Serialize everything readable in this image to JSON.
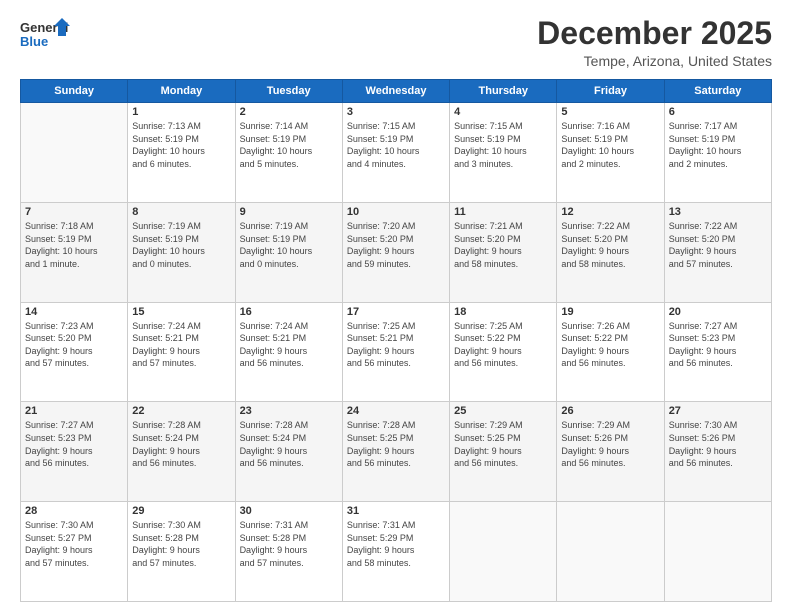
{
  "header": {
    "logo_line1": "General",
    "logo_line2": "Blue",
    "title": "December 2025",
    "subtitle": "Tempe, Arizona, United States"
  },
  "weekdays": [
    "Sunday",
    "Monday",
    "Tuesday",
    "Wednesday",
    "Thursday",
    "Friday",
    "Saturday"
  ],
  "weeks": [
    [
      {
        "day": "",
        "info": ""
      },
      {
        "day": "1",
        "info": "Sunrise: 7:13 AM\nSunset: 5:19 PM\nDaylight: 10 hours\nand 6 minutes."
      },
      {
        "day": "2",
        "info": "Sunrise: 7:14 AM\nSunset: 5:19 PM\nDaylight: 10 hours\nand 5 minutes."
      },
      {
        "day": "3",
        "info": "Sunrise: 7:15 AM\nSunset: 5:19 PM\nDaylight: 10 hours\nand 4 minutes."
      },
      {
        "day": "4",
        "info": "Sunrise: 7:15 AM\nSunset: 5:19 PM\nDaylight: 10 hours\nand 3 minutes."
      },
      {
        "day": "5",
        "info": "Sunrise: 7:16 AM\nSunset: 5:19 PM\nDaylight: 10 hours\nand 2 minutes."
      },
      {
        "day": "6",
        "info": "Sunrise: 7:17 AM\nSunset: 5:19 PM\nDaylight: 10 hours\nand 2 minutes."
      }
    ],
    [
      {
        "day": "7",
        "info": "Sunrise: 7:18 AM\nSunset: 5:19 PM\nDaylight: 10 hours\nand 1 minute."
      },
      {
        "day": "8",
        "info": "Sunrise: 7:19 AM\nSunset: 5:19 PM\nDaylight: 10 hours\nand 0 minutes."
      },
      {
        "day": "9",
        "info": "Sunrise: 7:19 AM\nSunset: 5:19 PM\nDaylight: 10 hours\nand 0 minutes."
      },
      {
        "day": "10",
        "info": "Sunrise: 7:20 AM\nSunset: 5:20 PM\nDaylight: 9 hours\nand 59 minutes."
      },
      {
        "day": "11",
        "info": "Sunrise: 7:21 AM\nSunset: 5:20 PM\nDaylight: 9 hours\nand 58 minutes."
      },
      {
        "day": "12",
        "info": "Sunrise: 7:22 AM\nSunset: 5:20 PM\nDaylight: 9 hours\nand 58 minutes."
      },
      {
        "day": "13",
        "info": "Sunrise: 7:22 AM\nSunset: 5:20 PM\nDaylight: 9 hours\nand 57 minutes."
      }
    ],
    [
      {
        "day": "14",
        "info": "Sunrise: 7:23 AM\nSunset: 5:20 PM\nDaylight: 9 hours\nand 57 minutes."
      },
      {
        "day": "15",
        "info": "Sunrise: 7:24 AM\nSunset: 5:21 PM\nDaylight: 9 hours\nand 57 minutes."
      },
      {
        "day": "16",
        "info": "Sunrise: 7:24 AM\nSunset: 5:21 PM\nDaylight: 9 hours\nand 56 minutes."
      },
      {
        "day": "17",
        "info": "Sunrise: 7:25 AM\nSunset: 5:21 PM\nDaylight: 9 hours\nand 56 minutes."
      },
      {
        "day": "18",
        "info": "Sunrise: 7:25 AM\nSunset: 5:22 PM\nDaylight: 9 hours\nand 56 minutes."
      },
      {
        "day": "19",
        "info": "Sunrise: 7:26 AM\nSunset: 5:22 PM\nDaylight: 9 hours\nand 56 minutes."
      },
      {
        "day": "20",
        "info": "Sunrise: 7:27 AM\nSunset: 5:23 PM\nDaylight: 9 hours\nand 56 minutes."
      }
    ],
    [
      {
        "day": "21",
        "info": "Sunrise: 7:27 AM\nSunset: 5:23 PM\nDaylight: 9 hours\nand 56 minutes."
      },
      {
        "day": "22",
        "info": "Sunrise: 7:28 AM\nSunset: 5:24 PM\nDaylight: 9 hours\nand 56 minutes."
      },
      {
        "day": "23",
        "info": "Sunrise: 7:28 AM\nSunset: 5:24 PM\nDaylight: 9 hours\nand 56 minutes."
      },
      {
        "day": "24",
        "info": "Sunrise: 7:28 AM\nSunset: 5:25 PM\nDaylight: 9 hours\nand 56 minutes."
      },
      {
        "day": "25",
        "info": "Sunrise: 7:29 AM\nSunset: 5:25 PM\nDaylight: 9 hours\nand 56 minutes."
      },
      {
        "day": "26",
        "info": "Sunrise: 7:29 AM\nSunset: 5:26 PM\nDaylight: 9 hours\nand 56 minutes."
      },
      {
        "day": "27",
        "info": "Sunrise: 7:30 AM\nSunset: 5:26 PM\nDaylight: 9 hours\nand 56 minutes."
      }
    ],
    [
      {
        "day": "28",
        "info": "Sunrise: 7:30 AM\nSunset: 5:27 PM\nDaylight: 9 hours\nand 57 minutes."
      },
      {
        "day": "29",
        "info": "Sunrise: 7:30 AM\nSunset: 5:28 PM\nDaylight: 9 hours\nand 57 minutes."
      },
      {
        "day": "30",
        "info": "Sunrise: 7:31 AM\nSunset: 5:28 PM\nDaylight: 9 hours\nand 57 minutes."
      },
      {
        "day": "31",
        "info": "Sunrise: 7:31 AM\nSunset: 5:29 PM\nDaylight: 9 hours\nand 58 minutes."
      },
      {
        "day": "",
        "info": ""
      },
      {
        "day": "",
        "info": ""
      },
      {
        "day": "",
        "info": ""
      }
    ]
  ],
  "colors": {
    "header_bg": "#1a6bbf",
    "header_text": "#ffffff",
    "border": "#cccccc",
    "title": "#333333",
    "logo_blue": "#1a6bbf"
  }
}
